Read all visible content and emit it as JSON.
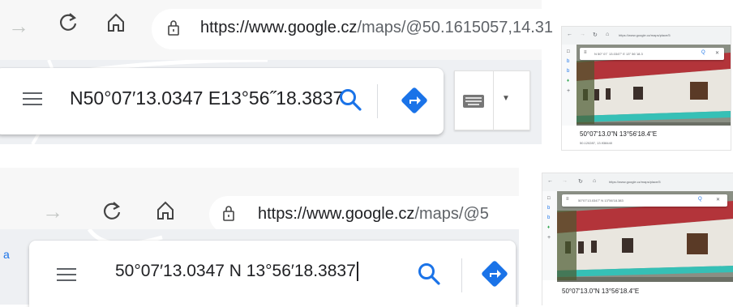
{
  "panel1": {
    "url_host": "https://www.google.cz",
    "url_rest": "/maps/@50.1615057,14.31",
    "search_value": "N50°07′13.0347 E13°56˝18.3837"
  },
  "panel2": {
    "url_host": "https://www.google.cz",
    "url_rest": "/maps/@5",
    "search_value": "50°07′13.0347 N 13°56′18.3837",
    "side_label": "a"
  },
  "thumb1": {
    "url": "https://www.google.cz/maps/place/5",
    "search_value": "N 50° 07´ 13.0347° E 13° 56´18.3",
    "place_title": "50°07'13.0\"N 13°56'18.4\"E",
    "place_coords": "50.120287, 13.938440"
  },
  "thumb2": {
    "url": "https://www.google.cz/maps/place/5",
    "search_value": "50°07'13.0347\" N 13°56'18.383",
    "place_title": "50°07'13.0\"N 13°56'18.4\"E"
  },
  "colors": {
    "search_icon": "#1a73e8",
    "directions": "#1a73e8",
    "roof": "#b3343a",
    "wall": "#e9e6df",
    "plinth": "#36c0b6"
  }
}
